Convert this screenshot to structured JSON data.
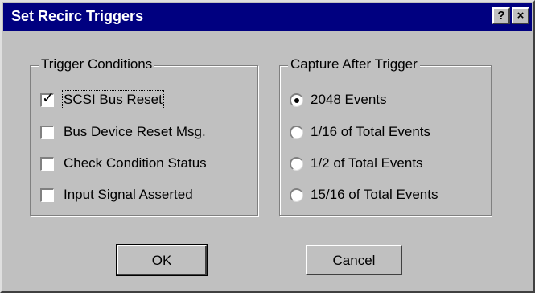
{
  "window": {
    "title": "Set Recirc Triggers",
    "help_label": "?",
    "close_label": "×"
  },
  "trigger_conditions": {
    "label": "Trigger Conditions",
    "items": [
      {
        "label": "SCSI Bus Reset",
        "checked": true
      },
      {
        "label": "Bus Device Reset Msg.",
        "checked": false
      },
      {
        "label": "Check Condition Status",
        "checked": false
      },
      {
        "label": "Input Signal Asserted",
        "checked": false
      }
    ]
  },
  "capture_after_trigger": {
    "label": "Capture After Trigger",
    "options": [
      {
        "label": "2048 Events",
        "selected": true
      },
      {
        "label": "1/16 of Total Events",
        "selected": false
      },
      {
        "label": "1/2 of Total Events",
        "selected": false
      },
      {
        "label": "15/16 of Total Events",
        "selected": false
      }
    ]
  },
  "buttons": {
    "ok_label": "OK",
    "cancel_label": "Cancel"
  }
}
